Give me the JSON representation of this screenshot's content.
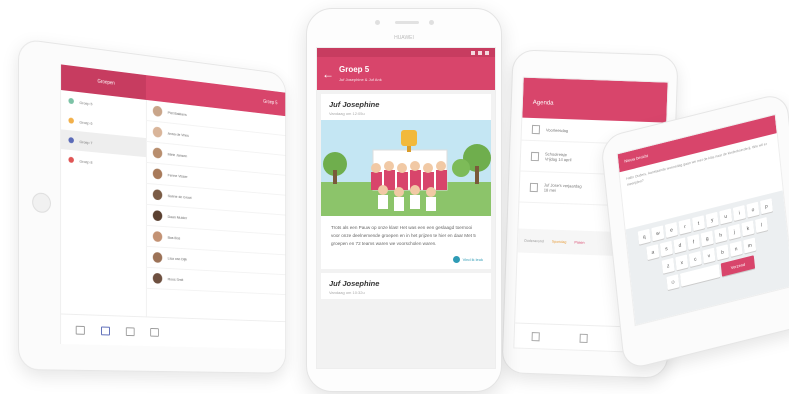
{
  "colors": {
    "brand": "#d8456b",
    "brand_dark": "#c73c60",
    "accent": "#2e9bb5"
  },
  "tablet": {
    "topbar_left": "Groepen",
    "topbar_right": "Groep 5",
    "sidebar_items": [
      {
        "label": "Groep 5",
        "color": "#7cc2a6"
      },
      {
        "label": "Groep 6",
        "color": "#f2b04a"
      },
      {
        "label": "Groep 7",
        "color": "#5b6bb8"
      },
      {
        "label": "Groep 8",
        "color": "#e05555"
      }
    ],
    "contacts": [
      "Piet Bakkers",
      "Anna de Vries",
      "Mirte Jansen",
      "Fenne Visser",
      "Sanne de Groot",
      "Daan Mulder",
      "Bas Bos",
      "Lisa van Dijk",
      "Roos Smit"
    ]
  },
  "main_phone": {
    "brand": "HUAWEI",
    "appbar_title": "Groep 5",
    "appbar_subtitle": "Juf Josephine & Juf Ank",
    "post": {
      "author": "Juf Josephine",
      "time": "Vandaag om 12:05u",
      "body": "Trots als een Pauw op onze klas! Het was een een geslaagd toernooi voor onze deelnemende groepen en in het prijzen te hier en daar Met 5 groepen en 72 teams waren we voorscholen waren."
    },
    "like_label": "Vind ik leuk",
    "next_post": {
      "author": "Juf Josephine",
      "time": "Vandaag om 10:32u"
    }
  },
  "right_phone": {
    "title": "Agenda",
    "rows": [
      "Voorleesdag",
      "Schoolreisje\nVrijdag 14 april",
      "Juf Jose's verjaardag\n18 mei"
    ],
    "strip_items": [
      "Ouderavond",
      "Sportdag",
      "Pasen"
    ]
  },
  "far_right_phone": {
    "header": "Nieuw bericht",
    "text": "Hallo Ouders, Aanstaande woensdag gaan we met de klas naar de kinderboerderij. Wie wil er meerijden?",
    "keys_row1": [
      "q",
      "w",
      "e",
      "r",
      "t",
      "y",
      "u",
      "i",
      "o",
      "p"
    ],
    "keys_row2": [
      "a",
      "s",
      "d",
      "f",
      "g",
      "h",
      "j",
      "k",
      "l"
    ],
    "keys_row3": [
      "z",
      "x",
      "c",
      "v",
      "b",
      "n",
      "m"
    ],
    "send_label": "Verzend"
  }
}
